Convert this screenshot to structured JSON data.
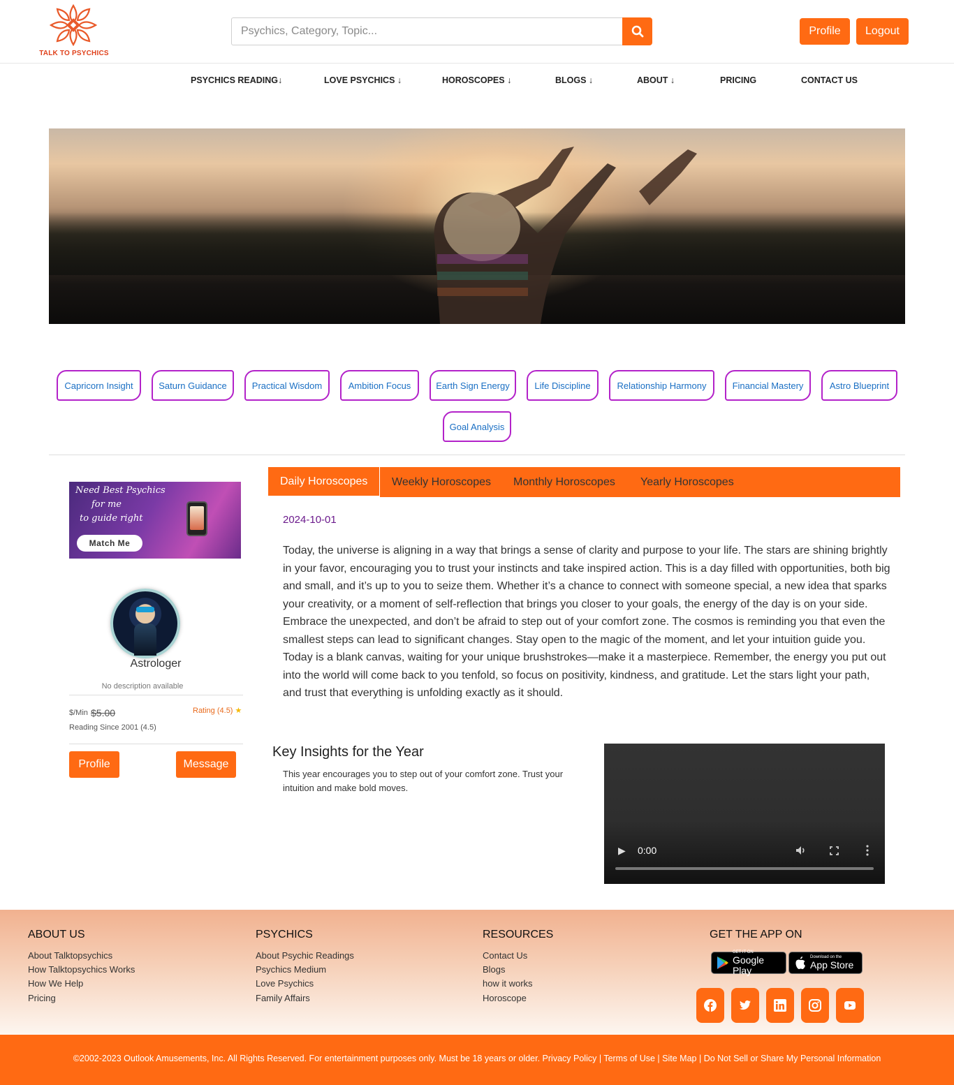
{
  "brand": {
    "name": "TALK TO PSYCHICS"
  },
  "search": {
    "placeholder": "Psychics, Category, Topic..."
  },
  "header": {
    "profile_label": "Profile",
    "logout_label": "Logout"
  },
  "nav": [
    "PSYCHICS READING↓",
    "LOVE PSYCHICS ↓",
    "HOROSCOPES ↓",
    "BLOGS ↓",
    "ABOUT ↓",
    "PRICING",
    "CONTACT US"
  ],
  "tags": [
    "Capricorn Insight",
    "Saturn Guidance",
    "Practical Wisdom",
    "Ambition Focus",
    "Earth Sign Energy",
    "Life Discipline",
    "Relationship Harmony",
    "Financial Mastery",
    "Astro Blueprint",
    "Goal Analysis"
  ],
  "ad": {
    "line1": "Need Best Psychics",
    "line2": "for me",
    "line3": "to guide right",
    "button": "Match Me"
  },
  "psychic": {
    "name": "Astrologer",
    "description": "No description available",
    "price_unit": "$/Min",
    "price": "$5.00",
    "rating": "Rating (4.5)",
    "since": "Reading Since 2001 (4.5)",
    "profile_label": "Profile",
    "message_label": "Message"
  },
  "tabs": [
    "Daily Horoscopes",
    "Weekly Horoscopes",
    "Monthly Horoscopes",
    "Yearly Horoscopes"
  ],
  "horoscope": {
    "date": "2024-10-01",
    "text": "Today, the universe is aligning in a way that brings a sense of clarity and purpose to your life. The stars are shining brightly in your favor, encouraging you to trust your instincts and take inspired action. This is a day filled with opportunities, both big and small, and it’s up to you to seize them. Whether it’s a chance to connect with someone special, a new idea that sparks your creativity, or a moment of self-reflection that brings you closer to your goals, the energy of the day is on your side. Embrace the unexpected, and don’t be afraid to step out of your comfort zone. The cosmos is reminding you that even the smallest steps can lead to significant changes. Stay open to the magic of the moment, and let your intuition guide you. Today is a blank canvas, waiting for your unique brushstrokes—make it a masterpiece. Remember, the energy you put out into the world will come back to you tenfold, so focus on positivity, kindness, and gratitude. Let the stars light your path, and trust that everything is unfolding exactly as it should."
  },
  "insights": {
    "title": "Key Insights for the Year",
    "text": "This year encourages you to step out of your comfort zone. Trust your intuition and make bold moves."
  },
  "video": {
    "time": "0:00"
  },
  "footer": {
    "about": {
      "heading": "ABOUT US",
      "links": [
        "About Talktopsychics",
        "How Talktopsychics Works",
        "How We Help",
        "Pricing"
      ]
    },
    "psychics": {
      "heading": "PSYCHICS",
      "links": [
        "About Psychic Readings",
        "Psychics Medium",
        "Love Psychics",
        "Family Affairs"
      ]
    },
    "resources": {
      "heading": "RESOURCES",
      "links": [
        "Contact Us",
        "Blogs",
        "how it works",
        "Horoscope"
      ]
    },
    "app": {
      "heading": "GET THE APP ON",
      "google_small": "GET IT ON",
      "google_big": "Google Play",
      "apple_small": "Download on the",
      "apple_big": "App Store"
    },
    "social_icons": [
      "facebook-icon",
      "twitter-icon",
      "linkedin-icon",
      "instagram-icon",
      "youtube-icon"
    ]
  },
  "copyright": {
    "text": "©2002-2023 Outlook Amusements, Inc. All Rights Reserved. For entertainment purposes only. Must be 18 years or older.",
    "privacy": "Privacy Policy",
    "terms": "Terms of Use",
    "sitemap": "Site Map",
    "donotsell": "Do Not Sell or Share My Personal Information"
  },
  "colors": {
    "accent": "#ff6a13",
    "tag_border": "#b322c9",
    "tag_text": "#1a6fc4",
    "date": "#6b1a8c"
  }
}
